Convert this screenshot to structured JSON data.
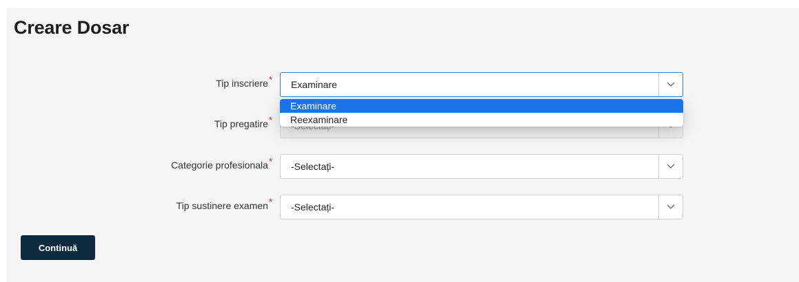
{
  "page": {
    "title": "Creare Dosar"
  },
  "form": {
    "required_marker": "*",
    "fields": [
      {
        "label": "Tip inscriere",
        "value": "Examinare"
      },
      {
        "label": "Tip pregatire",
        "value": "-Selectați-"
      },
      {
        "label": "Categorie profesionala",
        "value": "-Selectați-"
      },
      {
        "label": "Tip sustinere examen",
        "value": "-Selectați-"
      }
    ],
    "dropdown": {
      "options": [
        "Examinare",
        "Reexaminare"
      ],
      "selected": "Examinare"
    }
  },
  "actions": {
    "continue_label": "Continuă"
  },
  "icons": {
    "caret": "chevron-down-icon"
  },
  "colors": {
    "button_bg": "#0d2a3f",
    "highlight": "#1a73e8",
    "required": "#e02020",
    "active_border": "#3a7bd5"
  }
}
